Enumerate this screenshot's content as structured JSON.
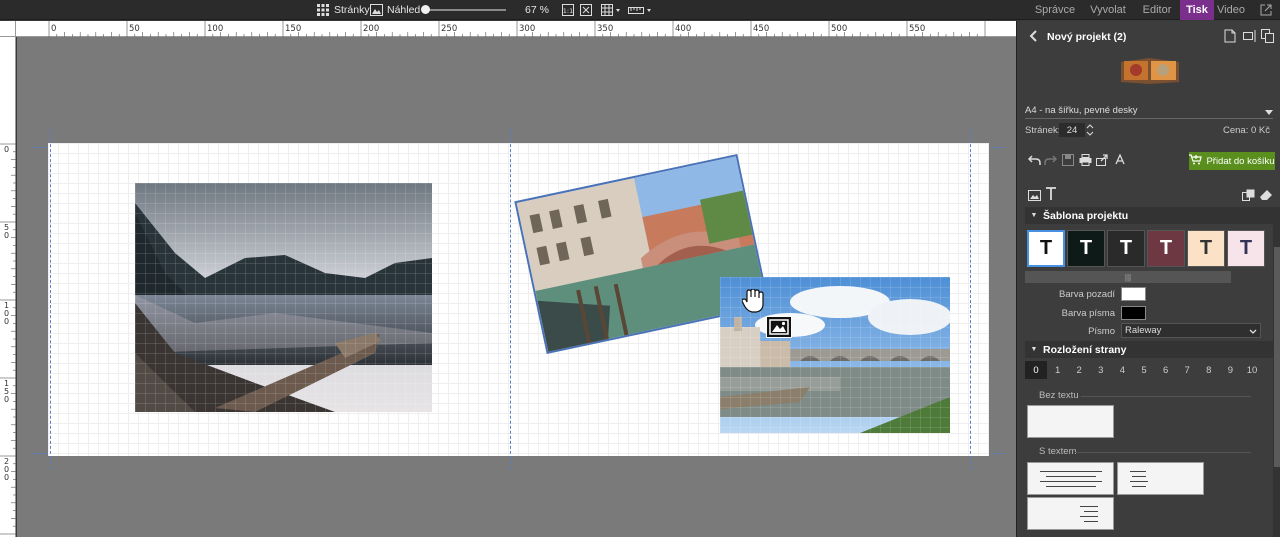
{
  "toolbar": {
    "pages_label": "Stránky",
    "preview_label": "Náhled",
    "zoom_value": "67 %",
    "zoom_slider_fraction": 0.0,
    "fit_icon": "fit-page-icon",
    "fullscreen_icon": "fullscreen-icon",
    "grid_icon": "grid-icon",
    "ruler_icon": "ruler-icon"
  },
  "nav": {
    "tabs": [
      {
        "label": "Správce",
        "active": false
      },
      {
        "label": "Vyvolat",
        "active": false
      },
      {
        "label": "Editor",
        "active": false
      },
      {
        "label": "Tisk",
        "active": true
      },
      {
        "label": "Video",
        "active": false
      }
    ],
    "accent": "#7b2f8c"
  },
  "rulers": {
    "top_ticks": [
      "0",
      "50",
      "100",
      "150",
      "200",
      "250",
      "300",
      "350",
      "400",
      "450",
      "500",
      "550"
    ],
    "left_ticks": [
      "0",
      "50",
      "100",
      "150",
      "200"
    ]
  },
  "panel": {
    "project_title": "Nový projekt (2)",
    "format_select": "A4 - na šířku, pevné desky",
    "pages_label": "Stránek:",
    "pages_value": "24",
    "price_label": "Cena: 0 Kč",
    "add_to_cart": "Přidat do košíku",
    "cart_color": "#5a8f1e",
    "template_section": "Šablona projektu",
    "swatches": [
      {
        "letter": "T",
        "bg": "#ffffff",
        "fg": "#111111",
        "selected": true
      },
      {
        "letter": "T",
        "bg": "#0d1a17",
        "fg": "#ffffff",
        "selected": false
      },
      {
        "letter": "T",
        "bg": "#2a2a2a",
        "fg": "#ffffff",
        "selected": false
      },
      {
        "letter": "T",
        "bg": "#6e3842",
        "fg": "#ffffff",
        "selected": false
      },
      {
        "letter": "T",
        "bg": "#fbe1c6",
        "fg": "#333333",
        "selected": false
      },
      {
        "letter": "T",
        "bg": "#f6e4ea",
        "fg": "#333355",
        "selected": false
      }
    ],
    "bg_color_label": "Barva pozadí",
    "bg_color": "#ffffff",
    "font_color_label": "Barva písma",
    "font_color": "#000000",
    "font_label": "Písmo",
    "font_value": "Raleway",
    "layout_section": "Rozložení strany",
    "layout_counts": [
      "0",
      "1",
      "2",
      "3",
      "4",
      "5",
      "6",
      "7",
      "8",
      "9",
      "10"
    ],
    "selected_count": "0",
    "no_text_label": "Bez textu",
    "with_text_label": "S textem"
  }
}
